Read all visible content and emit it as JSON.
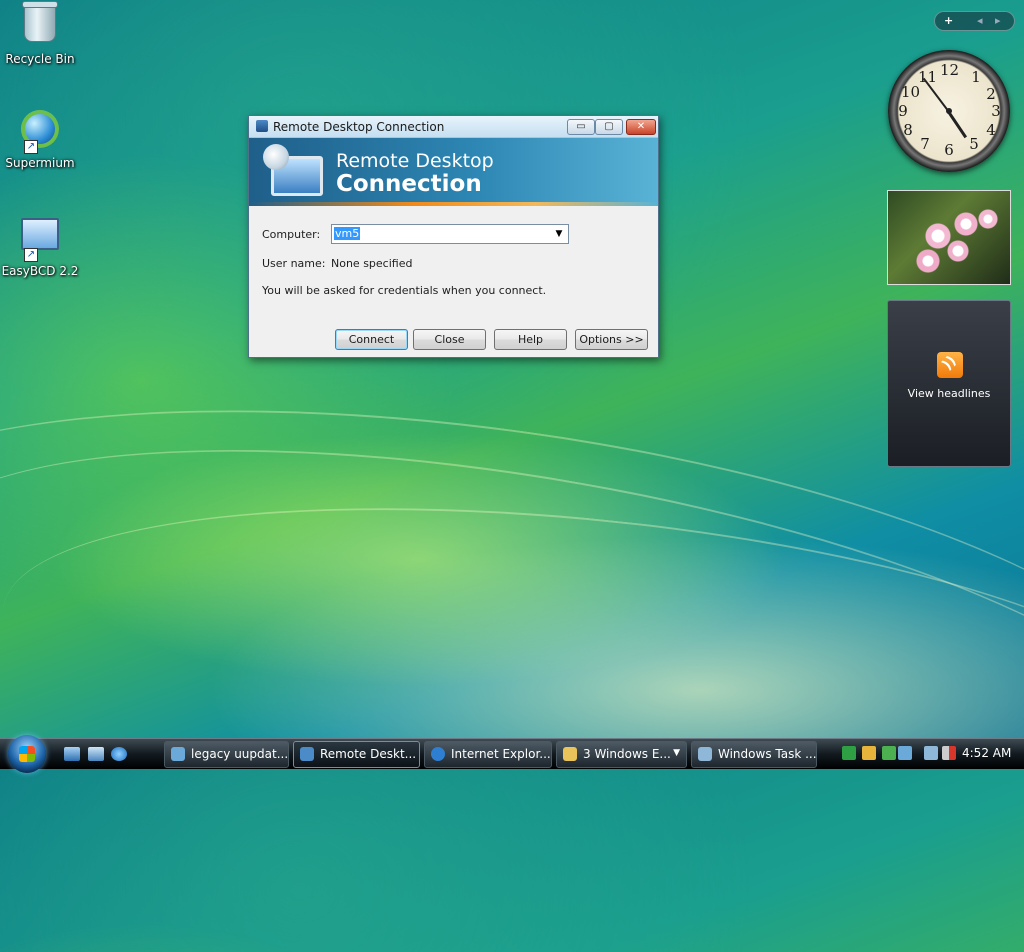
{
  "desktop": {
    "icons": [
      {
        "label": "Recycle Bin",
        "icon": "recycle-bin-icon"
      },
      {
        "label": "Supermium",
        "icon": "supermium-icon"
      },
      {
        "label": "EasyBCD 2.2",
        "icon": "easybcd-icon"
      }
    ]
  },
  "dialog": {
    "title": "Remote Desktop Connection",
    "banner_line1": "Remote Desktop",
    "banner_line2": "Connection",
    "computer_label": "Computer:",
    "computer_value": "vm5",
    "username_label": "User name:",
    "username_value": "None specified",
    "info": "You will be asked for credentials when you connect.",
    "buttons": {
      "connect": "Connect",
      "close": "Close",
      "help": "Help",
      "options": "Options >>"
    },
    "window_controls": {
      "minimize": "▭",
      "maximize": "▢",
      "close": "✕"
    }
  },
  "sidebar": {
    "controls": {
      "add": "+",
      "prev": "◂",
      "next": "▸"
    },
    "clock": {
      "numbers": [
        "12",
        "1",
        "2",
        "3",
        "4",
        "5",
        "6",
        "7",
        "8",
        "9",
        "10",
        "11"
      ],
      "time": "4:52"
    },
    "feed_label": "View headlines"
  },
  "taskbar": {
    "tasks": [
      {
        "label": "legacy uupdat...",
        "color": "#6aa9d8"
      },
      {
        "label": "Remote Deskt...",
        "color": "#4b8bc8"
      },
      {
        "label": "Internet Explor...",
        "color": "#2e7fd1"
      },
      {
        "label": "3 Windows E...",
        "color": "#e8c45a"
      },
      {
        "label": "Windows Task ...",
        "color": "#8fb7d8"
      }
    ],
    "clock": "4:52 AM",
    "colors": {
      "accent": "#3399ff"
    }
  }
}
